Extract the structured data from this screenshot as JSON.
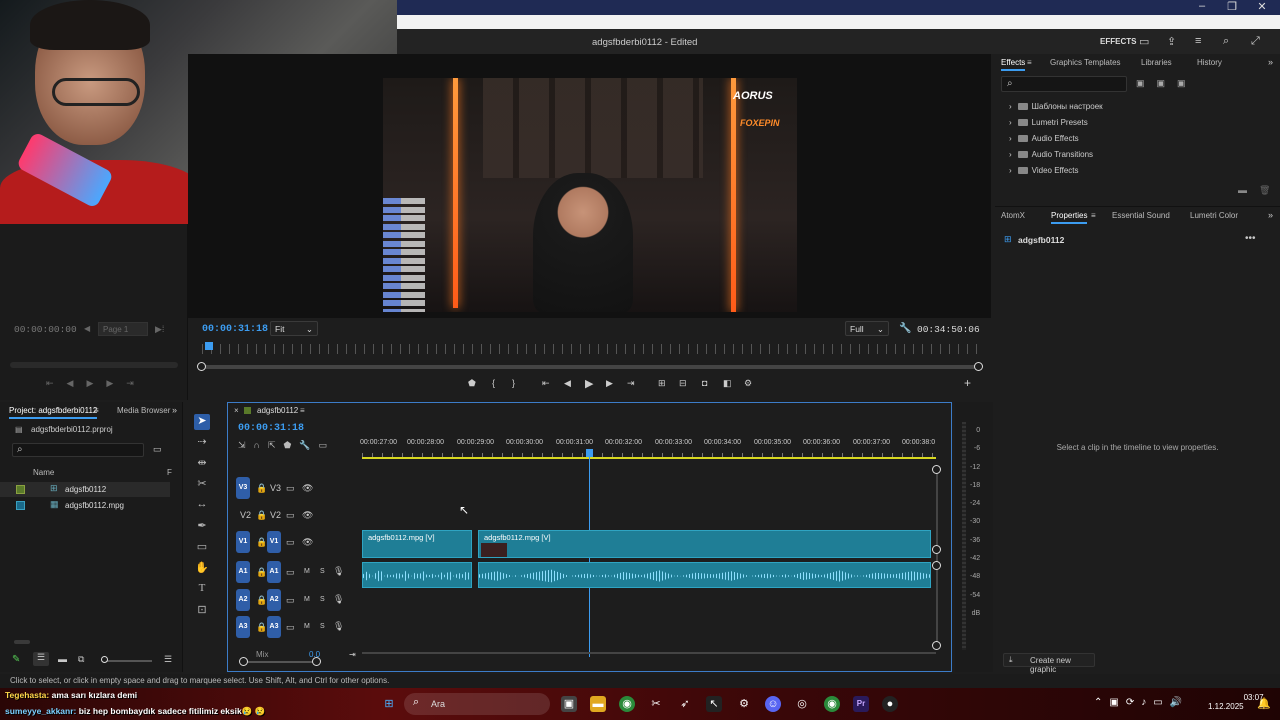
{
  "app": {
    "doc_title": "adgsfbderbi0112 - Edited",
    "workspace_label": "EFFECTS"
  },
  "source_monitor": {
    "timecode": "00:00:00:00",
    "page_label": "Page 1"
  },
  "program_monitor": {
    "timecode": "00:00:31:18",
    "fit_label": "Fit",
    "quality_label": "Full",
    "duration": "00:34:50:06",
    "overlay_logo_1": "AORUS",
    "overlay_logo_2": "FOXEPIN"
  },
  "effects_panel": {
    "tabs": [
      "Effects",
      "Graphics Templates",
      "Libraries",
      "History"
    ],
    "folders": [
      "Шаблоны настроек",
      "Lumetri Presets",
      "Audio Effects",
      "Audio Transitions",
      "Video Effects"
    ]
  },
  "properties_panel": {
    "tabs": [
      "AtomX",
      "Properties",
      "Essential Sound",
      "Lumetri Color"
    ],
    "item_name": "adgsfb0112",
    "hint": "Select a clip in the timeline to view properties.",
    "create_graphic": "Create new graphic"
  },
  "project_panel": {
    "tab_label": "Project: adgsfbderbi0112",
    "tab2_label": "Media Browser",
    "file_name": "adgsfbderbi0112.prproj",
    "col_name": "Name",
    "col_f": "F",
    "items": [
      "adgsfb0112",
      "adgsfb0112.mpg"
    ]
  },
  "timeline": {
    "sequence_name": "adgsfb0112",
    "timecode": "00:00:31:18",
    "ruler": [
      "00:00:27:00",
      "00:00:28:00",
      "00:00:29:00",
      "00:00:30:00",
      "00:00:31:00",
      "00:00:32:00",
      "00:00:33:00",
      "00:00:34:00",
      "00:00:35:00",
      "00:00:36:00",
      "00:00:37:00",
      "00:00:38:0"
    ],
    "video_tracks": [
      "V3",
      "V2",
      "V1"
    ],
    "audio_tracks": [
      "A1",
      "A2",
      "A3"
    ],
    "mix_label": "Mix",
    "mix_value": "0.0",
    "clip_v1_a": "adgsfb0112.mpg [V]",
    "clip_v1_b": "adgsfb0112.mpg [V]",
    "m_label": "M",
    "s_label": "S"
  },
  "audio_meter": {
    "ticks": [
      "0",
      "-6",
      "-12",
      "-18",
      "-24",
      "-30",
      "-36",
      "-42",
      "-48",
      "-54",
      "dB"
    ]
  },
  "status_bar": {
    "text": "Click to select, or click in empty space and drag to marquee select. Use Shift, Alt, and Ctrl for other options."
  },
  "stream_chat": [
    {
      "user": "Tegehasta:",
      "msg": "ama sarı kızlara demi",
      "color": "#ffd84a"
    },
    {
      "user": "sumeyye_akkanr:",
      "msg": "biz hep bombaydık sadece fitilimiz eksik😢 😢",
      "color": "#7ad0ff"
    }
  ],
  "taskbar": {
    "search_placeholder": "Ara",
    "time": "03:07",
    "date": "1.12.2025"
  },
  "colors": {
    "accent": "#3c9cf0",
    "clip": "#1f7e96",
    "title_bar": "#1f2a54",
    "track_pill": "#2f5ea8"
  }
}
